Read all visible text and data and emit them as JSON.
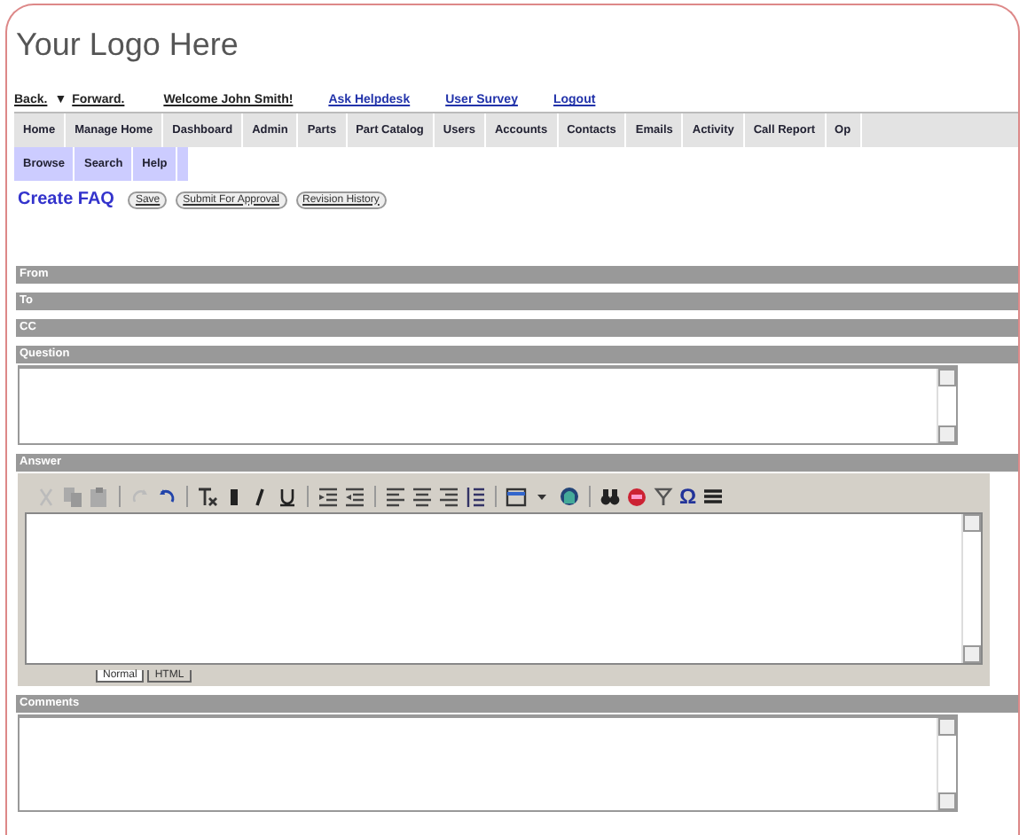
{
  "logo": "Your Logo Here",
  "top_links": [
    {
      "label": "Back.",
      "kind": "plain"
    },
    {
      "label": "▼",
      "kind": "caret"
    },
    {
      "label": "Forward.",
      "kind": "plain"
    },
    {
      "label": "Welcome John Smith!",
      "kind": "plain"
    },
    {
      "label": "Ask Helpdesk",
      "kind": "link"
    },
    {
      "label": "User Survey",
      "kind": "link"
    },
    {
      "label": "Logout",
      "kind": "link"
    }
  ],
  "menu": [
    "Home",
    "Manage Home",
    "Dashboard",
    "Admin",
    "Parts",
    "Part Catalog",
    "Users",
    "Accounts",
    "Contacts",
    "Emails",
    "Activity",
    "Call Report",
    "Op"
  ],
  "submenu": [
    "Browse",
    "Search",
    "Help"
  ],
  "page_title": "Create FAQ",
  "actions": [
    "Save",
    "Submit For Approval",
    "Revision History"
  ],
  "sections": [
    {
      "label": "From",
      "kind": "bar"
    },
    {
      "label": "To",
      "kind": "bar"
    },
    {
      "label": "CC",
      "kind": "bar"
    },
    {
      "label": "Question",
      "kind": "textarea"
    },
    {
      "label": "Answer",
      "kind": "editor"
    },
    {
      "label": "Comments",
      "kind": "textarea"
    }
  ],
  "editor": {
    "special_char": "Ω",
    "modes": [
      {
        "label": "Normal",
        "selected": true
      },
      {
        "label": "HTML",
        "selected": false
      }
    ]
  }
}
